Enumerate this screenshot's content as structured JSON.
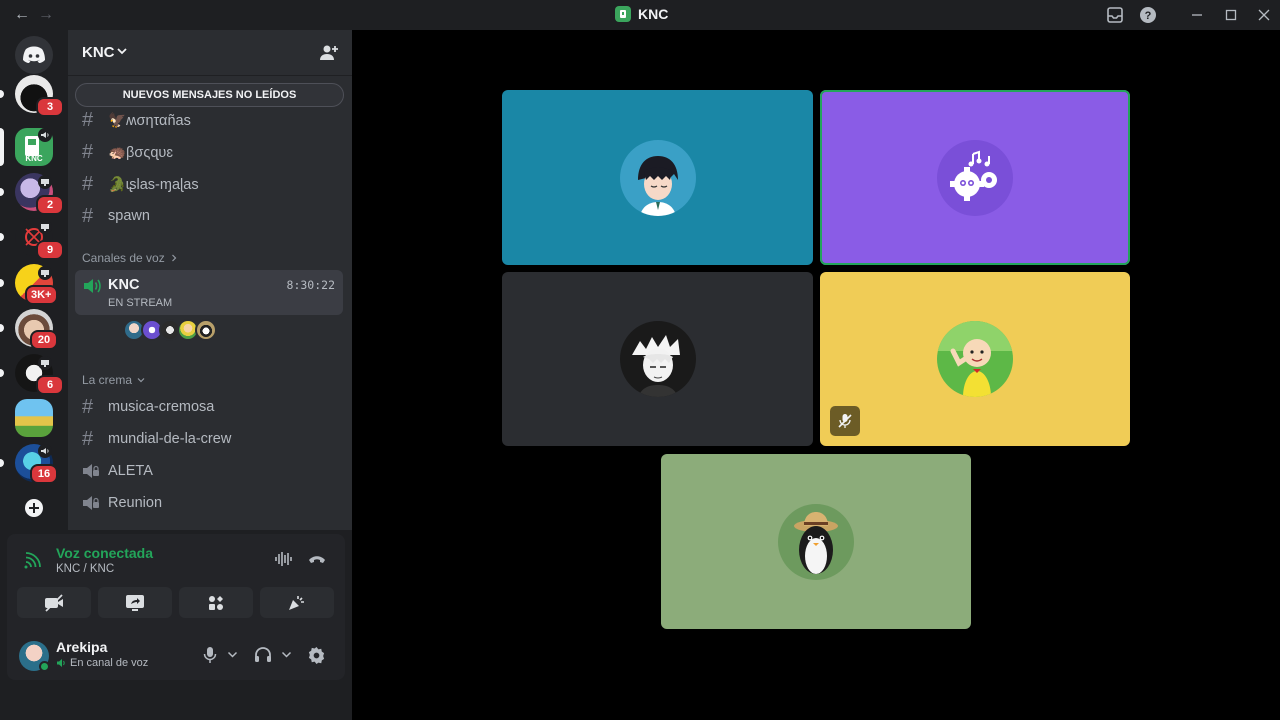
{
  "window": {
    "title": "KNC",
    "back_glyph": "←",
    "forward_glyph": "→"
  },
  "servers": [
    {
      "name": "server-cat",
      "badge": "3"
    },
    {
      "name": "server-knc",
      "badge": ""
    },
    {
      "name": "server-anime",
      "badge": "2"
    },
    {
      "name": "server-red",
      "badge": "9"
    },
    {
      "name": "server-simpson",
      "badge": "3K+"
    },
    {
      "name": "server-face",
      "badge": "20"
    },
    {
      "name": "server-mask",
      "badge": "6"
    },
    {
      "name": "server-minecraft",
      "badge": ""
    },
    {
      "name": "server-blue",
      "badge": "16"
    }
  ],
  "guild": {
    "name": "KNC",
    "unread_banner": "NUEVOS MENSAJES NO LEÍDOS"
  },
  "channels_top": [
    {
      "name": "🦅ʍσηταñas"
    },
    {
      "name": "🦔βσςɋυɛ"
    },
    {
      "name": "🐊ɩʂlas-ɱaɭas"
    },
    {
      "name": "spawn"
    }
  ],
  "voice_category": "Canales de voz",
  "voice_channel": {
    "name": "KNC",
    "status": "EN STREAM",
    "timer": "8:30:22"
  },
  "cream_category": "La crema",
  "channels_cream": [
    {
      "name": "musica-cremosa",
      "type": "text"
    },
    {
      "name": "mundial-de-la-crew",
      "type": "text"
    },
    {
      "name": "ALETA",
      "type": "voice"
    },
    {
      "name": "Reunion",
      "type": "voice"
    }
  ],
  "voice_panel": {
    "status": "Voz conectada",
    "location": "KNC / KNC"
  },
  "user": {
    "name": "Arekipa",
    "status": "En canal de voz"
  },
  "tiles": [
    {
      "name": "tile-anime-boy",
      "color": "#1a87a6"
    },
    {
      "name": "tile-bot-gears",
      "color": "#8a5ce6",
      "speaking": true
    },
    {
      "name": "tile-manga",
      "color": "#2b2d31"
    },
    {
      "name": "tile-caillou",
      "color": "#f0cc56",
      "muted": true
    },
    {
      "name": "tile-penguin",
      "color": "#8cac7a"
    }
  ],
  "colors": {
    "accent_green": "#23a55a",
    "badge_red": "#da373c",
    "rail_bg": "#1e1f22",
    "sidebar_bg": "#2b2d31"
  }
}
